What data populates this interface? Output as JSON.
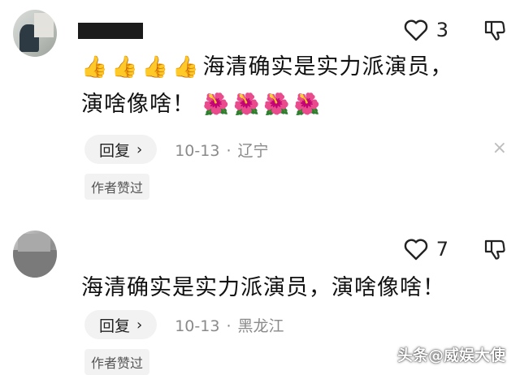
{
  "comments": [
    {
      "like_count": "3",
      "text_line1": "海清确实是实力派演员，",
      "text_line2": "演啥像啥！",
      "thumbs": [
        "👍",
        "👍",
        "👍",
        "👍"
      ],
      "flowers": [
        "🌺",
        "🌺",
        "🌺",
        "🌺"
      ],
      "reply_label": "回复",
      "date": "10-13",
      "separator": "·",
      "location": "辽宁",
      "badge": "作者赞过",
      "close_glyph": "×"
    },
    {
      "like_count": "7",
      "text": "海清确实是实力派演员，演啥像啥！",
      "reply_label": "回复",
      "date": "10-13",
      "separator": "·",
      "location": "黑龙江",
      "badge": "作者赞过"
    }
  ],
  "icons": {
    "like": "heart-outline-icon",
    "dislike": "thumbs-down-outline-icon",
    "chevron": "chevron-right-icon"
  },
  "watermark": "头条@威娱大使",
  "colors": {
    "meta_gray": "#8a8a8a",
    "chip_bg": "#f2f2f2",
    "text": "#111111"
  }
}
